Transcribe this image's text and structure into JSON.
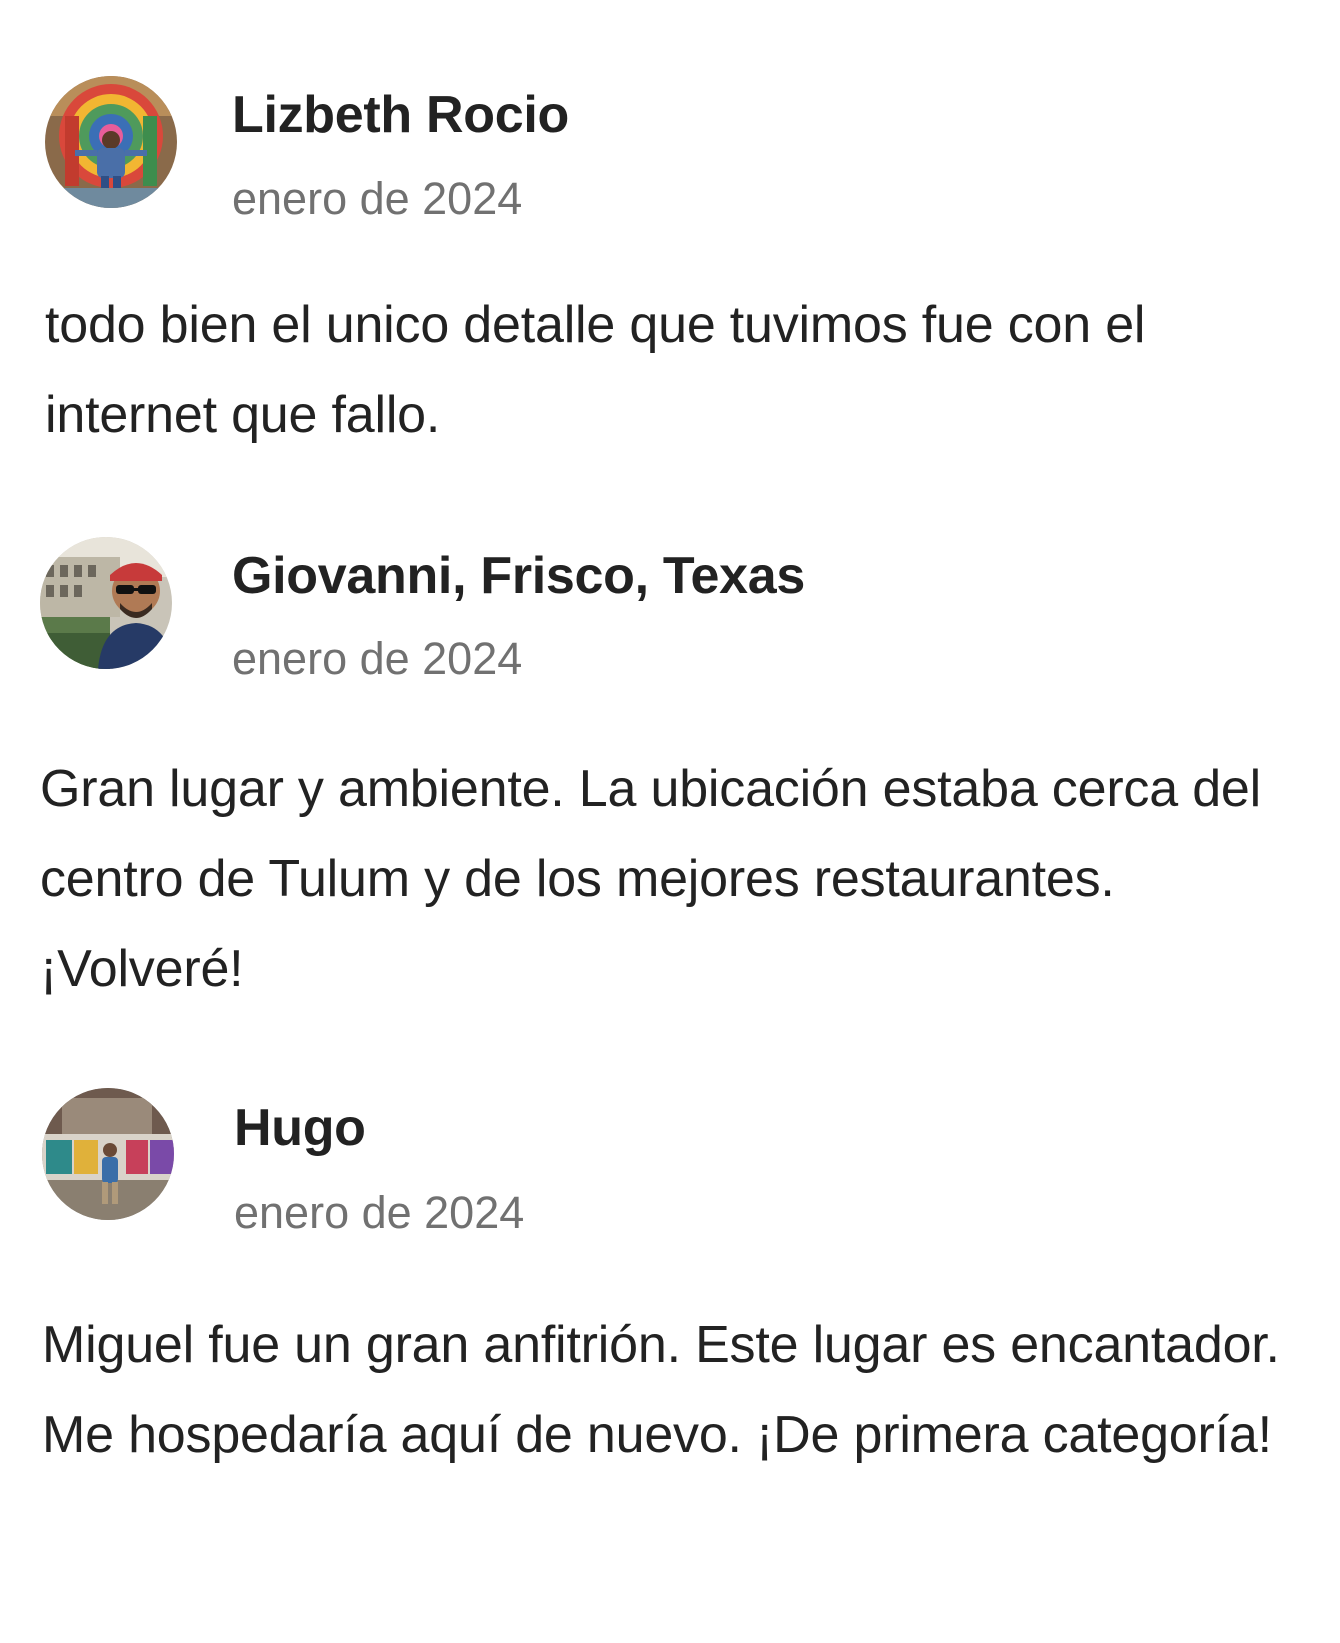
{
  "reviews": [
    {
      "name": "Lizbeth Rocio",
      "date": "enero de 2024",
      "text": "todo bien el unico detalle que tuvimos fue con el internet que fallo."
    },
    {
      "name": "Giovanni, Frisco, Texas",
      "date": "enero de 2024",
      "text": "Gran lugar y ambiente. La ubicación estaba cerca del centro de Tulum y de los mejores restaurantes. ¡Volveré!"
    },
    {
      "name": "Hugo",
      "date": "enero de 2024",
      "text": "Miguel fue un gran anfitrión. Este lugar es encantador. Me hospedaría aquí de nuevo. ¡De primera categoría!"
    }
  ]
}
